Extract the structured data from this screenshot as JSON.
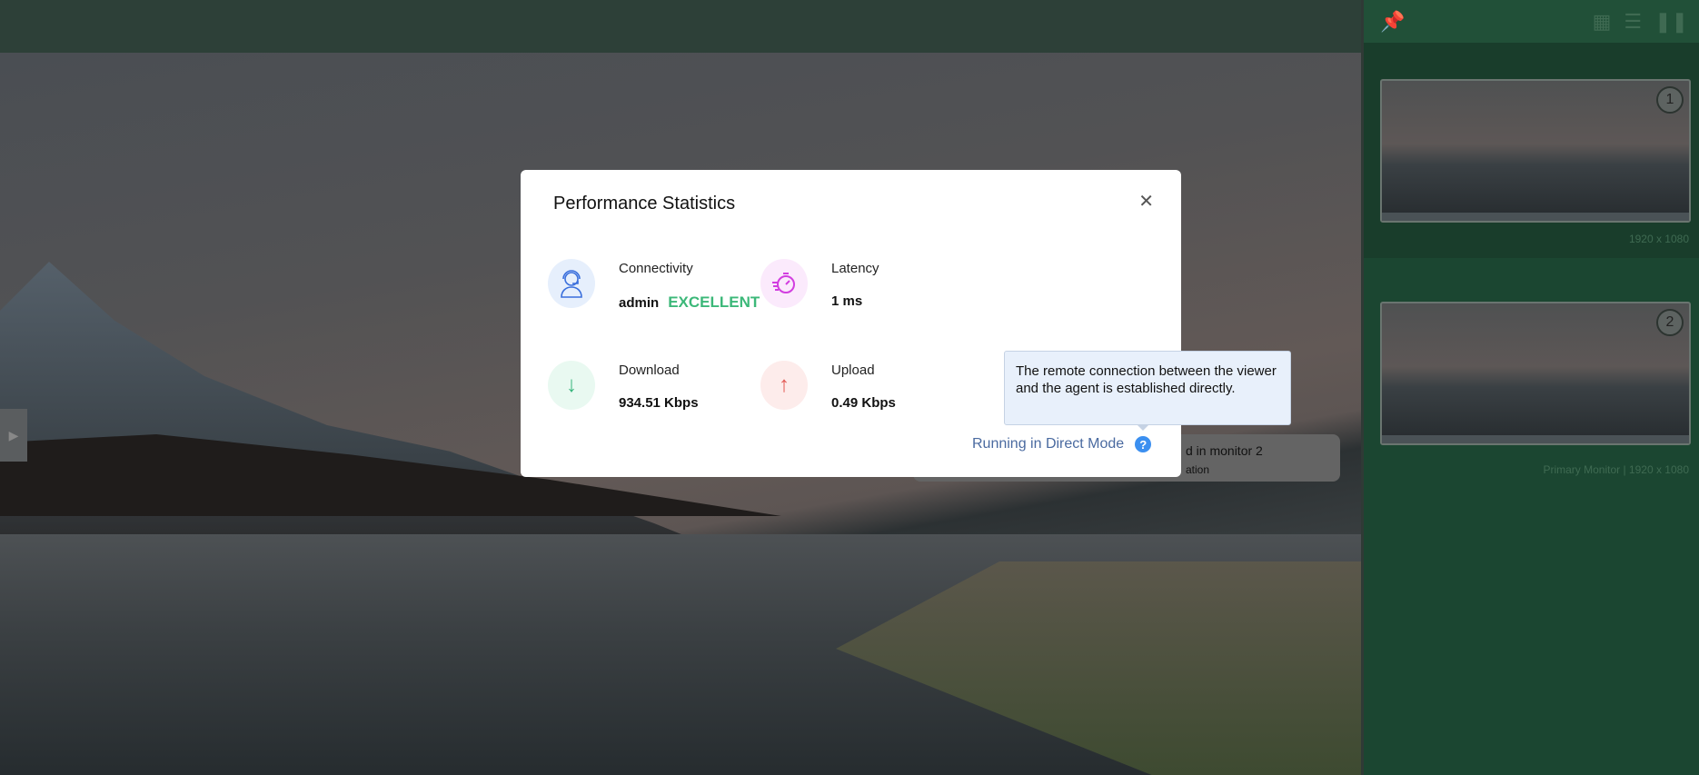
{
  "dialog": {
    "title": "Performance Statistics",
    "connectivity": {
      "label": "Connectivity",
      "user": "admin",
      "status": "EXCELLENT"
    },
    "latency": {
      "label": "Latency",
      "value": "1 ms"
    },
    "download": {
      "label": "Download",
      "value": "934.51 Kbps"
    },
    "upload": {
      "label": "Upload",
      "value": "0.49 Kbps"
    },
    "mode": "Running in Direct Mode"
  },
  "tooltip": "The remote connection between the viewer and the agent is established directly.",
  "notification": {
    "line1": "d in monitor 2",
    "line2": "ation"
  },
  "monitors": [
    {
      "number": "1",
      "label": "1920 x 1080"
    },
    {
      "number": "2",
      "label": "Primary Monitor | 1920 x 1080"
    }
  ],
  "colors": {
    "excellent": "#3cb879",
    "mode": "#4a6aa0",
    "sidebar": "#1b4631"
  }
}
